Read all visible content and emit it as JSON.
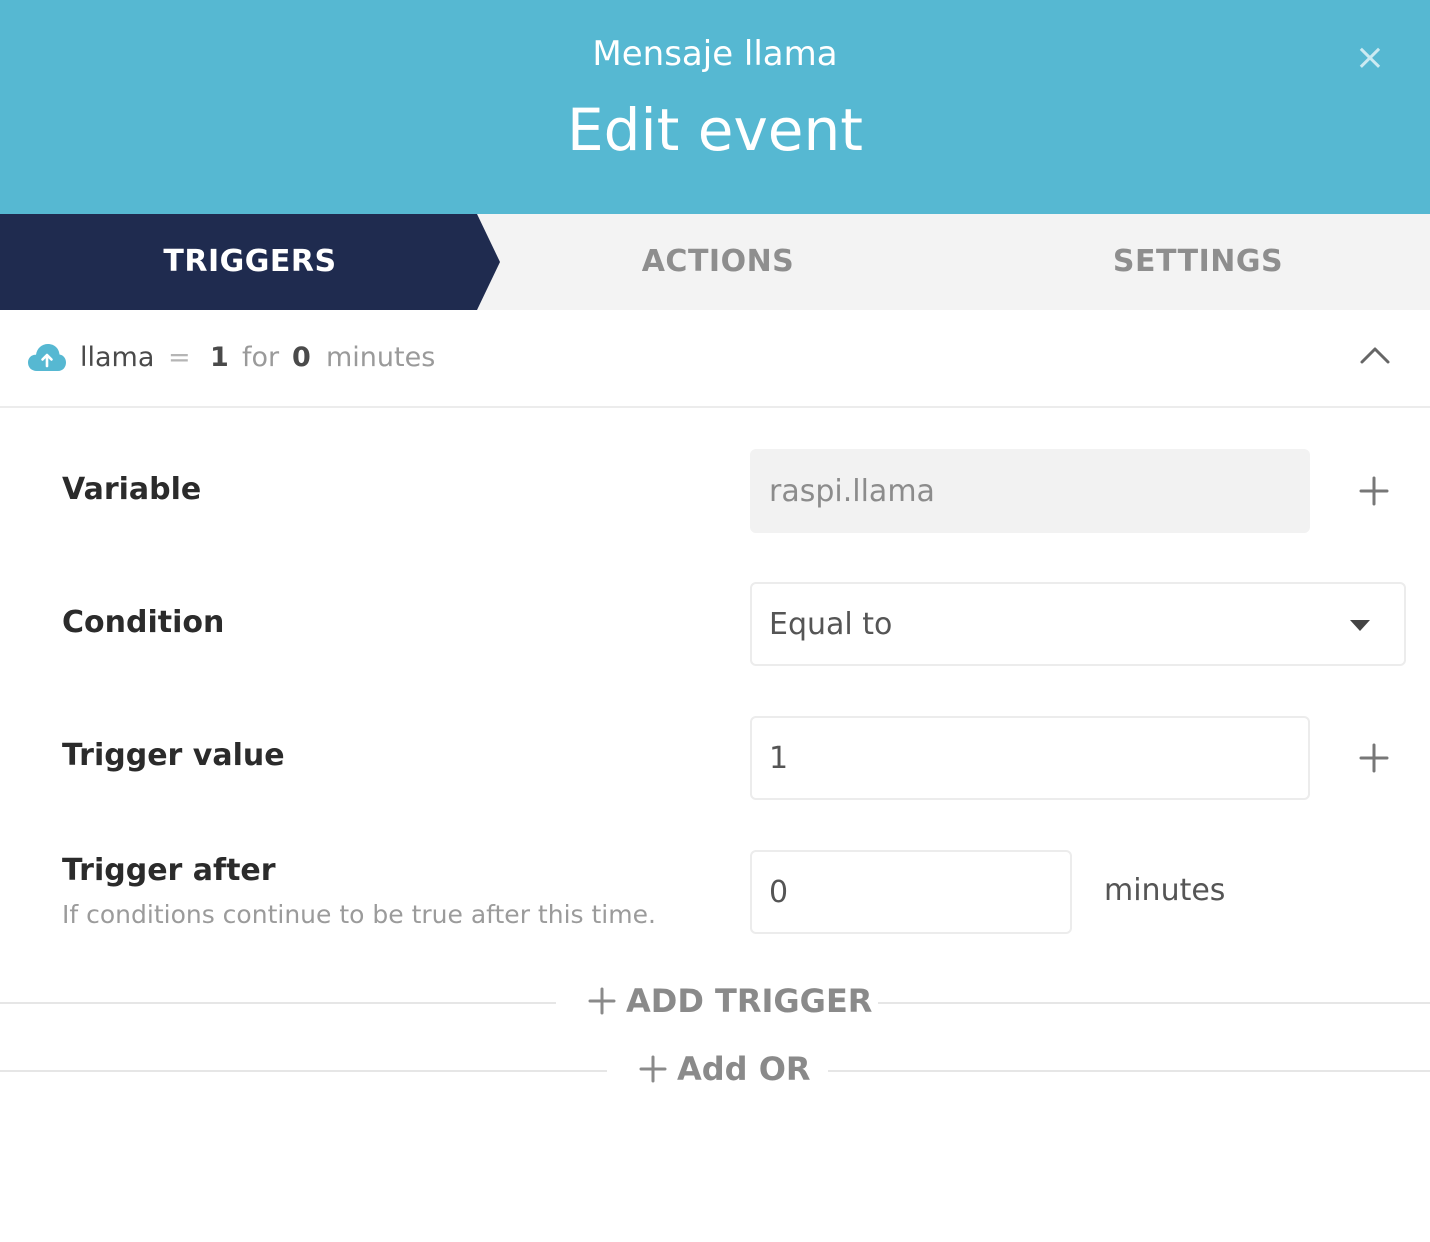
{
  "header": {
    "subtitle": "Mensaje llama",
    "title": "Edit event",
    "close_glyph": "×",
    "background": "#56b8d2"
  },
  "tabs": [
    {
      "label": "TRIGGERS",
      "active": true
    },
    {
      "label": "ACTIONS",
      "active": false
    },
    {
      "label": "SETTINGS",
      "active": false
    }
  ],
  "summary": {
    "icon": "cloud-upload-icon",
    "variable": "llama",
    "operator": "=",
    "value": "1",
    "for_word": "for",
    "duration": "0",
    "unit": "minutes",
    "expanded": true
  },
  "form": {
    "variable": {
      "label": "Variable",
      "value": "raspi.llama"
    },
    "condition": {
      "label": "Condition",
      "selected": "Equal to"
    },
    "trigger_value": {
      "label": "Trigger value",
      "value": "1"
    },
    "trigger_after": {
      "label": "Trigger after",
      "help": "If conditions continue to be true after this time.",
      "value": "0",
      "unit": "minutes"
    }
  },
  "add_trigger_label": "ADD TRIGGER",
  "add_or_label": "Add OR",
  "colors": {
    "accent": "#56b8d2",
    "active_tab": "#1f2b4f"
  }
}
